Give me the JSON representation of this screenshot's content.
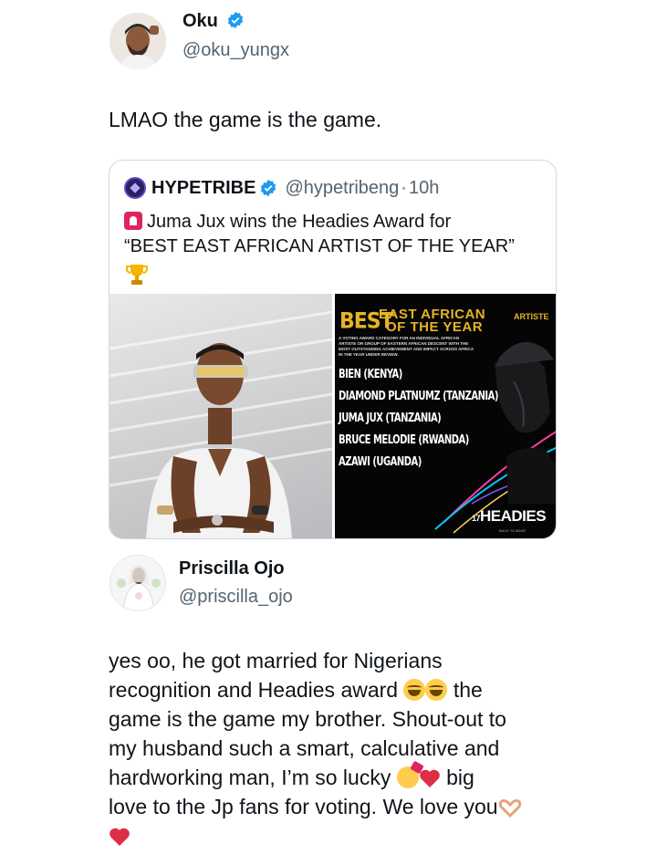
{
  "tweet": {
    "author_name": "Oku",
    "author_handle": "@oku_yungx",
    "text": "LMAO the game is the game."
  },
  "quoted_tweet": {
    "author_name": "HYPETRIBE",
    "author_handle": "@hypetribeng",
    "time_separator": "·",
    "time": "10h",
    "text_line1": "Juma Jux wins the Headies Award for",
    "text_line2": "“BEST EAST AFRICAN ARTIST OF THE YEAR”",
    "emoji": [
      "rotating-light-icon",
      "trophy-icon"
    ],
    "poster": {
      "best": "BEST",
      "east_african": "EAST AFRICAN",
      "of_the_year": "OF THE YEAR",
      "artiste": "ARTISTE",
      "description": "A voting award category for an individual African artiste or group of Eastern African descent with the most outstanding achievement and impact across Africa in the year under review.",
      "nominees": [
        "BIEN (KENYA)",
        "DIAMOND PLATNUMZ (TANZANIA)",
        "JUMA JUX (TANZANIA)",
        "BRUCE MELODIE (RWANDA)",
        "AZAWI (UGANDA)"
      ],
      "logo_number": "17",
      "logo_text": "HEADIES",
      "logo_sub": "BACK TO BASE"
    }
  },
  "reply_tweet": {
    "author_name": "Priscilla Ojo",
    "author_handle": "@priscilla_ojo",
    "line1": "yes oo, he got married for Nigerians",
    "line2_a": "recognition and Headies award",
    "line2_b": "the",
    "line3": "game is the game my brother. Shout-out to",
    "line4": "my husband such a smart, calculative and",
    "line5_a": "hardworking  man, I’m so lucky",
    "line5_b": "big",
    "line6": "love to the Jp fans for voting. We love you",
    "emoji": [
      "laughing-tears-icon",
      "laughing-tears-icon",
      "party-face-icon",
      "red-heart-icon",
      "heart-hands-icon",
      "red-heart-icon"
    ]
  },
  "colors": {
    "text_primary": "#0f1419",
    "text_secondary": "#536471",
    "verified_blue": "#1d9bf0",
    "poster_gold": "#e6b422",
    "border": "#cfd9de"
  }
}
